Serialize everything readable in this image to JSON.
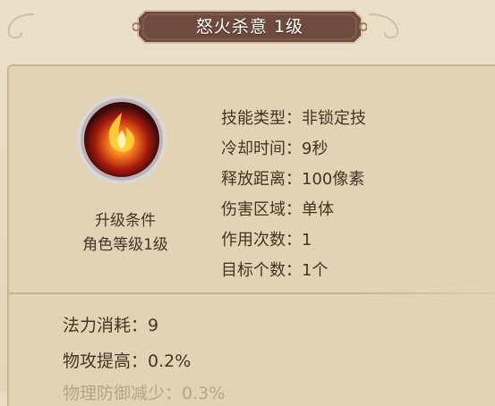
{
  "title": "怒火杀意 1级",
  "skill_icon": "flame-skill-icon",
  "upgrade": {
    "title": "升级条件",
    "value": "角色等级1级"
  },
  "attributes": [
    {
      "label": "技能类型：",
      "value": "非锁定技"
    },
    {
      "label": "冷却时间：",
      "value": "9秒"
    },
    {
      "label": "释放距离：",
      "value": "100像素"
    },
    {
      "label": "伤害区域：",
      "value": "单体"
    },
    {
      "label": "作用次数：",
      "value": "1"
    },
    {
      "label": "目标个数：",
      "value": "1个"
    }
  ],
  "effects": [
    {
      "label": "法力消耗：",
      "value": "9"
    },
    {
      "label": "物攻提高：",
      "value": "0.2%"
    },
    {
      "label": "物理防御减少：",
      "value": "0.3%"
    }
  ],
  "colors": {
    "banner": "#6e4a3f",
    "text": "#4a3326",
    "background": "#e9dcc2"
  }
}
